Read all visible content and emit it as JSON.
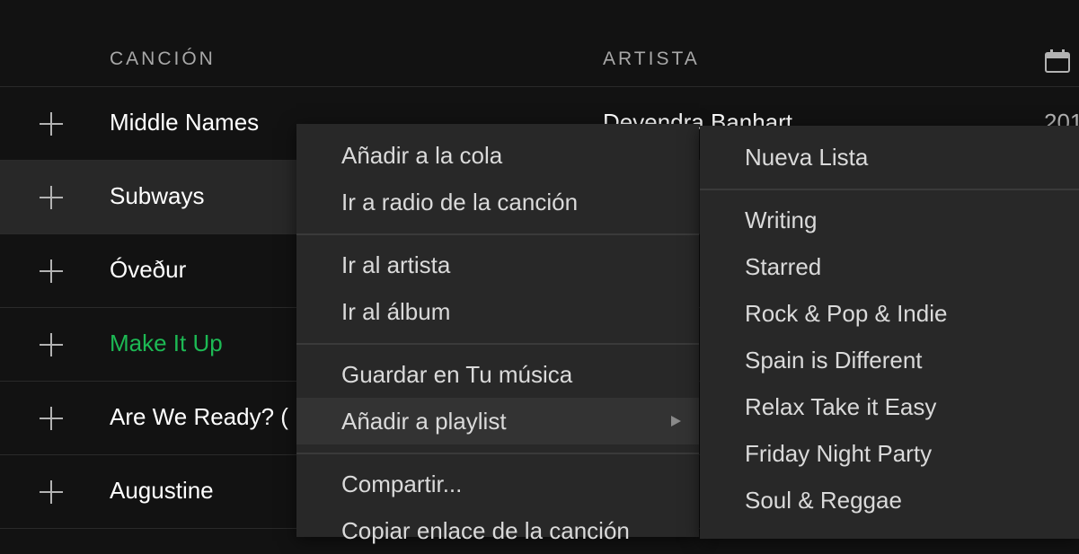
{
  "header": {
    "song_col": "CANCIÓN",
    "artist_col": "ARTISTA",
    "date_icon": "calendar-icon"
  },
  "tracks": [
    {
      "title": "Middle Names",
      "artist": "Devendra Banhart",
      "date": "201"
    },
    {
      "title": "Subways"
    },
    {
      "title": "Óveður"
    },
    {
      "title": "Make It Up",
      "playing": true
    },
    {
      "title": "Are We Ready? ("
    },
    {
      "title": "Augustine"
    }
  ],
  "context_menu": {
    "items": [
      "Añadir a la cola",
      "Ir a radio de la canción",
      "Ir al artista",
      "Ir al álbum",
      "Guardar en Tu música",
      "Añadir a playlist",
      "Compartir...",
      "Copiar enlace de la canción"
    ]
  },
  "playlist_menu": {
    "new_list": "Nueva Lista",
    "playlists": [
      "Writing",
      "Starred",
      "Rock & Pop & Indie",
      "Spain is Different",
      "Relax Take it Easy",
      "Friday Night Party",
      "Soul & Reggae"
    ]
  },
  "colors": {
    "background": "#121212",
    "hover_row": "#282828",
    "accent_green": "#1db954",
    "menu_bg": "#282828"
  }
}
